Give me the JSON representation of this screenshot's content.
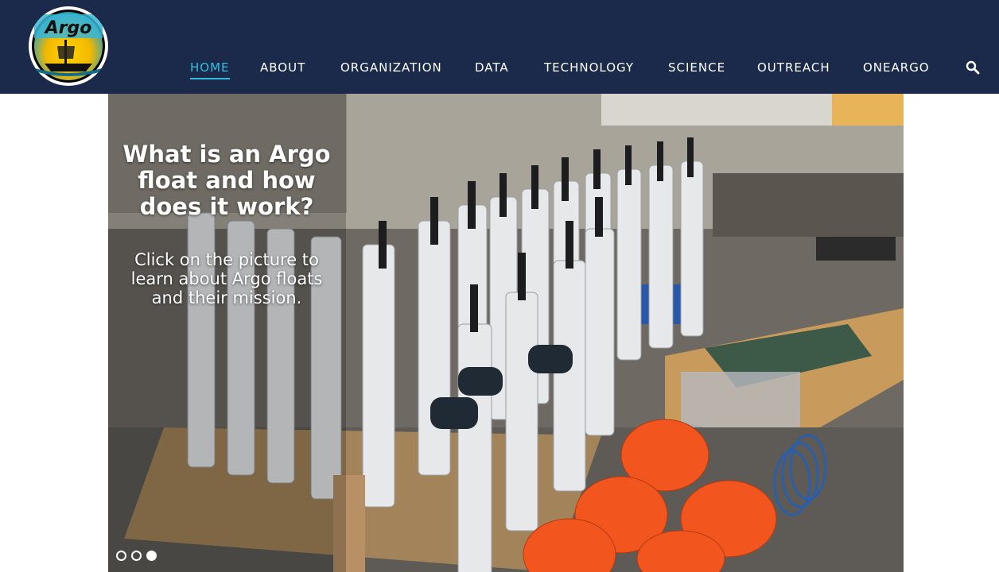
{
  "header": {
    "logo_text": "Argo",
    "colors": {
      "background": "#1b2a4a",
      "active": "#33bedf",
      "text": "#ffffff"
    }
  },
  "nav": {
    "items": [
      {
        "label": "HOME",
        "active": true
      },
      {
        "label": "ABOUT"
      },
      {
        "label": "ORGANIZATION"
      },
      {
        "label": "DATA"
      },
      {
        "label": "TECHNOLOGY"
      },
      {
        "label": "SCIENCE"
      },
      {
        "label": "OUTREACH"
      },
      {
        "label": "ONEARGO"
      }
    ],
    "search_icon": "search-icon"
  },
  "hero": {
    "title": "What is an Argo float and how does it work?",
    "subtitle": "Click on the picture to learn about Argo floats and their mission.",
    "slide_count": 3,
    "active_slide": 3
  }
}
